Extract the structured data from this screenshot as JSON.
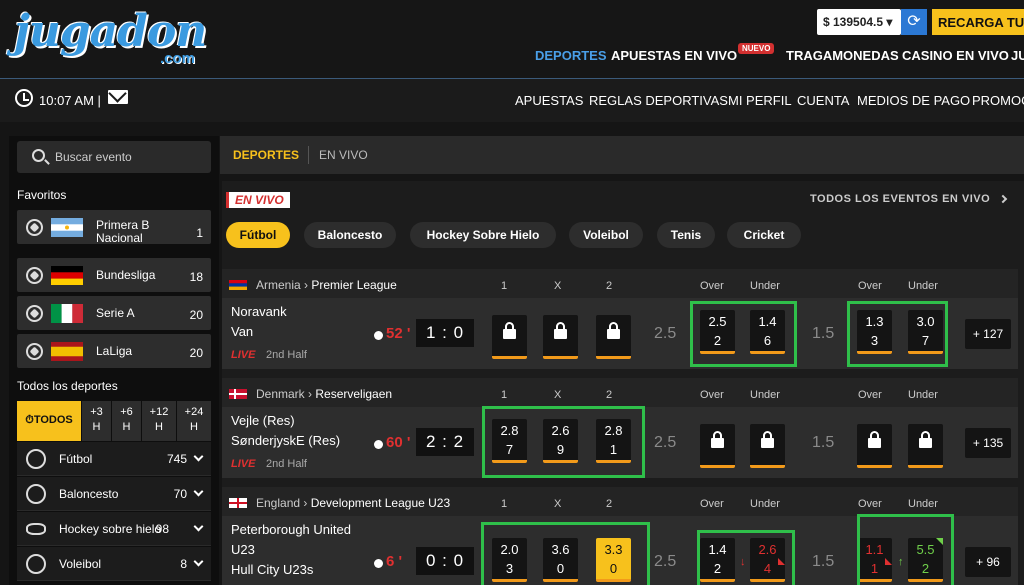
{
  "header": {
    "logo": "jugadon",
    "logo_sub": ".com",
    "balance": "$ 139504.5 ▾",
    "recarga": "RECARGA TU C",
    "nav": [
      "DEPORTES",
      "APUESTAS EN VIVO",
      "TRAGAMONEDAS",
      "CASINO EN VIVO",
      "JU"
    ],
    "nuevo_badge": "NUEVO",
    "time": "10:07 AM |",
    "subnav": [
      "APUESTAS",
      "REGLAS DEPORTIVAS",
      "MI PERFIL",
      "CUENTA",
      "MEDIOS DE PAGO",
      "PROMOC"
    ],
    "accent": "#f7c11c",
    "active_nav_color": "#4a9fe8"
  },
  "sidebar": {
    "search_placeholder": "Buscar evento",
    "favoritos_label": "Favoritos",
    "favorites": [
      {
        "name_line1": "Primera B",
        "name_line2": "Nacional",
        "count": "1"
      },
      {
        "name_line1": "Bundesliga",
        "name_line2": "",
        "count": "18"
      },
      {
        "name_line1": "Serie A",
        "name_line2": "",
        "count": "20"
      },
      {
        "name_line1": "LaLiga",
        "name_line2": "",
        "count": "20"
      }
    ],
    "todos_label": "Todos los deportes",
    "time_filters": {
      "todos": "TODOS",
      "f3": [
        "+3",
        "H"
      ],
      "f6": [
        "+6",
        "H"
      ],
      "f12": [
        "+12",
        "H"
      ],
      "f24": [
        "+24",
        "H"
      ]
    },
    "sports": [
      {
        "name": "Fútbol",
        "count": "745"
      },
      {
        "name": "Baloncesto",
        "count": "70"
      },
      {
        "name": "Hockey sobre hielo",
        "count": "98"
      },
      {
        "name": "Voleibol",
        "count": "8"
      }
    ]
  },
  "main": {
    "tabs": [
      "DEPORTES",
      "EN VIVO"
    ],
    "envivo": "EN VIVO",
    "todos_eventos": "TODOS LOS EVENTOS EN VIVO",
    "pills": [
      "Fútbol",
      "Baloncesto",
      "Hockey Sobre Hielo",
      "Voleibol",
      "Tenis",
      "Cricket"
    ],
    "col_labels": {
      "one": "1",
      "x": "X",
      "two": "2",
      "over": "Over",
      "under": "Under"
    },
    "live_label": "LIVE",
    "half_label": "2nd Half",
    "events": [
      {
        "country": "Armenia",
        "league": "Premier League",
        "team1": "Noravank",
        "team2": "Van",
        "minute": "52 '",
        "score": "1 : 0",
        "line1": "2.5",
        "line2": "1.5",
        "o1_over": [
          "2.5",
          "2"
        ],
        "o1_under": [
          "1.4",
          "6"
        ],
        "o2_over": [
          "1.3",
          "3"
        ],
        "o2_under": [
          "3.0",
          "7"
        ],
        "more": "+ 127"
      },
      {
        "country": "Denmark",
        "league": "Reserveligaen",
        "team1": "Vejle (Res)",
        "team2": "SønderjyskE (Res)",
        "minute": "60 '",
        "score": "2 : 2",
        "line1": "2.5",
        "line2": "1.5",
        "o_1": [
          "2.8",
          "7"
        ],
        "o_x": [
          "2.6",
          "9"
        ],
        "o_2": [
          "2.8",
          "1"
        ],
        "more": "+ 135"
      },
      {
        "country": "England",
        "league": "Development League U23",
        "team1": "Peterborough United",
        "team1b": "U23",
        "team2": "Hull City U23s",
        "minute": "6 '",
        "score": "0 : 0",
        "line1": "2.5",
        "line2": "1.5",
        "o_1": [
          "2.0",
          "3"
        ],
        "o_x": [
          "3.6",
          "0"
        ],
        "o_2": [
          "3.3",
          "0"
        ],
        "o1_over": [
          "1.4",
          "2"
        ],
        "o1_under": [
          "2.6",
          "4"
        ],
        "o2_over": [
          "1.1",
          "1"
        ],
        "o2_under": [
          "5.5",
          "2"
        ],
        "more": "+ 96"
      }
    ]
  }
}
